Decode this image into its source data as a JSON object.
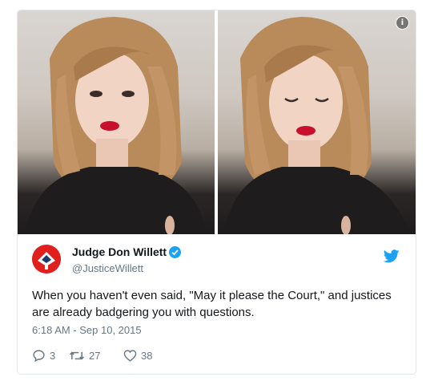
{
  "tweet": {
    "display_name": "Judge Don Willett",
    "handle": "@JusticeWillett",
    "text": "When you haven't even said, \"May it please the Court,\" and justices are already badgering you with questions.",
    "timestamp": "6:18 AM - Sep 10, 2015",
    "verified": true,
    "media_info_symbol": "i"
  },
  "actions": {
    "replies": "3",
    "retweets": "27",
    "likes": "38"
  },
  "colors": {
    "brand_blue": "#1da1f2",
    "text_primary": "#14171a",
    "text_secondary": "#657786",
    "border": "#e1e8ed",
    "avatar_bg": "#e0201c"
  },
  "icons": [
    "info-icon",
    "verified-icon",
    "twitter-bird-icon",
    "reply-icon",
    "retweet-icon",
    "like-icon"
  ]
}
